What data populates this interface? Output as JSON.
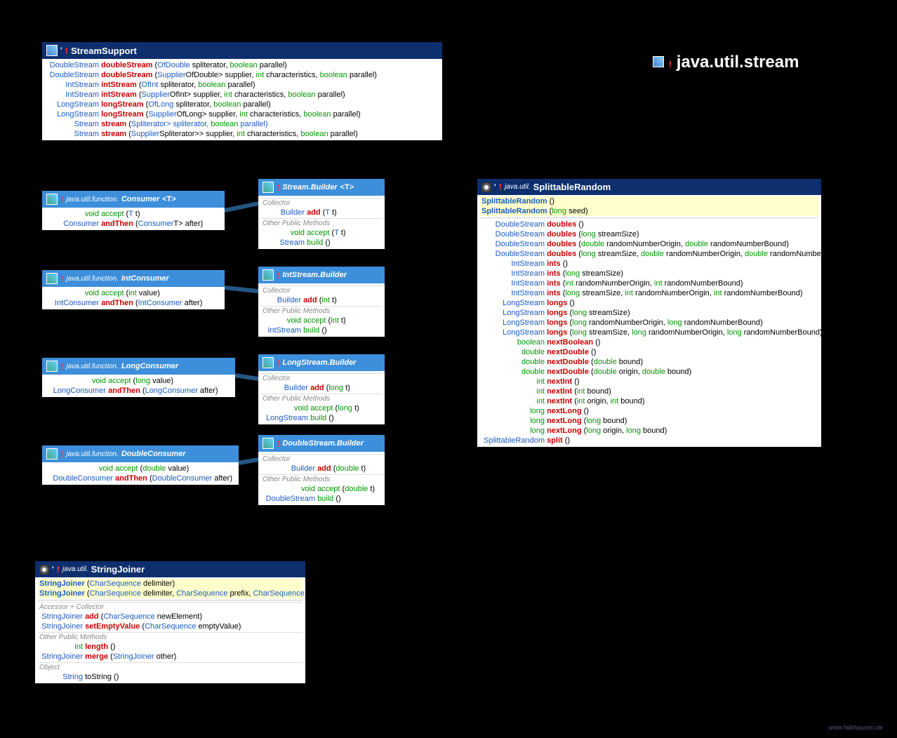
{
  "title": {
    "icon": "class-icon",
    "bang": "!",
    "text": "java.util.stream"
  },
  "footer": "www.falkhausen.de",
  "streamSupport": {
    "header": {
      "bang": "!",
      "name": "StreamSupport"
    },
    "methods": [
      {
        "ret": "DoubleStream",
        "name": "doubleStream",
        "nameClass": "name-r",
        "sig": "(OfDouble spliterator, boolean parallel)",
        "types": [
          [
            "OfDouble",
            "typ"
          ],
          [
            "boolean",
            "kw"
          ]
        ]
      },
      {
        "ret": "DoubleStream",
        "name": "doubleStream",
        "nameClass": "name-r",
        "sig": "(Supplier<? extends OfDouble> supplier, int characteristics, boolean parallel)"
      },
      {
        "ret": "IntStream",
        "name": "intStream",
        "nameClass": "name-r",
        "sig": "(OfInt spliterator, boolean parallel)"
      },
      {
        "ret": "IntStream",
        "name": "intStream",
        "nameClass": "name-r",
        "sig": "(Supplier<? extends OfInt> supplier, int characteristics, boolean parallel)"
      },
      {
        "ret": "LongStream",
        "name": "longStream",
        "nameClass": "name-r",
        "sig": "(OfLong spliterator, boolean parallel)"
      },
      {
        "ret": "LongStream",
        "name": "longStream",
        "nameClass": "name-r",
        "sig": "(Supplier<? extends OfLong> supplier, int characteristics, boolean parallel)"
      },
      {
        "ret": "<T> Stream<T>",
        "name": "stream",
        "nameClass": "name-r",
        "sig": "(Spliterator<T> spliterator, boolean parallel)"
      },
      {
        "ret": "<T> Stream<T>",
        "name": "stream",
        "nameClass": "name-r",
        "sig": "(Supplier<? extends Spliterator<T>> supplier, int characteristics, boolean parallel)"
      }
    ]
  },
  "consumer": {
    "header": {
      "bang": "!",
      "pkg": "java.util.function.",
      "name": "Consumer",
      "tp": "<T>"
    },
    "methods": [
      {
        "ret": "void",
        "name": "accept",
        "nameClass": "name-g",
        "sig": "(T t)"
      },
      {
        "ret": "Consumer<T>",
        "name": "andThen",
        "nameClass": "name-r",
        "sig": "(Consumer<? super T> after)"
      }
    ]
  },
  "intConsumer": {
    "header": {
      "bang": "!",
      "pkg": "java.util.function.",
      "name": "IntConsumer"
    },
    "methods": [
      {
        "ret": "void",
        "name": "accept",
        "nameClass": "name-g",
        "sig": "(int value)"
      },
      {
        "ret": "IntConsumer",
        "name": "andThen",
        "nameClass": "name-r",
        "sig": "(IntConsumer after)"
      }
    ]
  },
  "longConsumer": {
    "header": {
      "bang": "!",
      "pkg": "java.util.function.",
      "name": "LongConsumer"
    },
    "methods": [
      {
        "ret": "void",
        "name": "accept",
        "nameClass": "name-g",
        "sig": "(long value)"
      },
      {
        "ret": "LongConsumer",
        "name": "andThen",
        "nameClass": "name-r",
        "sig": "(LongConsumer after)"
      }
    ]
  },
  "doubleConsumer": {
    "header": {
      "bang": "!",
      "pkg": "java.util.function.",
      "name": "DoubleConsumer"
    },
    "methods": [
      {
        "ret": "void",
        "name": "accept",
        "nameClass": "name-g",
        "sig": "(double value)"
      },
      {
        "ret": "DoubleConsumer",
        "name": "andThen",
        "nameClass": "name-r",
        "sig": "(DoubleConsumer after)"
      }
    ]
  },
  "streamBuilder": {
    "header": {
      "bang": "!",
      "name": "Stream.Builder",
      "tp": "<T>"
    },
    "sections": [
      {
        "label": "Collector",
        "rows": [
          {
            "ret": "Builder<T>",
            "name": "add",
            "nameClass": "name-r",
            "sig": "(T t)"
          }
        ]
      },
      {
        "label": "Other Public Methods",
        "rows": [
          {
            "ret": "void",
            "name": "accept",
            "nameClass": "name-g",
            "sig": "(T t)"
          },
          {
            "ret": "Stream<T>",
            "name": "build",
            "nameClass": "name-g",
            "sig": "()"
          }
        ]
      }
    ]
  },
  "intStreamBuilder": {
    "header": {
      "bang": "!",
      "name": "IntStream.Builder"
    },
    "sections": [
      {
        "label": "Collector",
        "rows": [
          {
            "ret": "Builder",
            "name": "add",
            "nameClass": "name-r",
            "sig": "(int t)"
          }
        ]
      },
      {
        "label": "Other Public Methods",
        "rows": [
          {
            "ret": "void",
            "name": "accept",
            "nameClass": "name-g",
            "sig": "(int t)"
          },
          {
            "ret": "IntStream",
            "name": "build",
            "nameClass": "name-g",
            "sig": "()"
          }
        ]
      }
    ]
  },
  "longStreamBuilder": {
    "header": {
      "bang": "!",
      "name": "LongStream.Builder"
    },
    "sections": [
      {
        "label": "Collector",
        "rows": [
          {
            "ret": "Builder",
            "name": "add",
            "nameClass": "name-r",
            "sig": "(long t)"
          }
        ]
      },
      {
        "label": "Other Public Methods",
        "rows": [
          {
            "ret": "void",
            "name": "accept",
            "nameClass": "name-g",
            "sig": "(long t)"
          },
          {
            "ret": "LongStream",
            "name": "build",
            "nameClass": "name-g",
            "sig": "()"
          }
        ]
      }
    ]
  },
  "doubleStreamBuilder": {
    "header": {
      "bang": "!",
      "name": "DoubleStream.Builder"
    },
    "sections": [
      {
        "label": "Collector",
        "rows": [
          {
            "ret": "Builder",
            "name": "add",
            "nameClass": "name-r",
            "sig": "(double t)"
          }
        ]
      },
      {
        "label": "Other Public Methods",
        "rows": [
          {
            "ret": "void",
            "name": "accept",
            "nameClass": "name-g",
            "sig": "(double t)"
          },
          {
            "ret": "DoubleStream",
            "name": "build",
            "nameClass": "name-g",
            "sig": "()"
          }
        ]
      }
    ]
  },
  "splittableRandom": {
    "header": {
      "bang": "!",
      "pkg": "java.util.",
      "name": "SplittableRandom"
    },
    "ctors": [
      {
        "name": "SplittableRandom",
        "sig": "()"
      },
      {
        "name": "SplittableRandom",
        "sig": "(long seed)"
      }
    ],
    "methods": [
      {
        "ret": "DoubleStream",
        "name": "doubles",
        "nameClass": "name-r",
        "sig": "()"
      },
      {
        "ret": "DoubleStream",
        "name": "doubles",
        "nameClass": "name-r",
        "sig": "(long streamSize)"
      },
      {
        "ret": "DoubleStream",
        "name": "doubles",
        "nameClass": "name-r",
        "sig": "(double randomNumberOrigin, double randomNumberBound)"
      },
      {
        "ret": "DoubleStream",
        "name": "doubles",
        "nameClass": "name-r",
        "sig": "(long streamSize, double randomNumberOrigin, double randomNumberBound)"
      },
      {
        "ret": "IntStream",
        "name": "ints",
        "nameClass": "name-r",
        "sig": "()"
      },
      {
        "ret": "IntStream",
        "name": "ints",
        "nameClass": "name-r",
        "sig": "(long streamSize)"
      },
      {
        "ret": "IntStream",
        "name": "ints",
        "nameClass": "name-r",
        "sig": "(int randomNumberOrigin, int randomNumberBound)"
      },
      {
        "ret": "IntStream",
        "name": "ints",
        "nameClass": "name-r",
        "sig": "(long streamSize, int randomNumberOrigin, int randomNumberBound)"
      },
      {
        "ret": "LongStream",
        "name": "longs",
        "nameClass": "name-r",
        "sig": "()"
      },
      {
        "ret": "LongStream",
        "name": "longs",
        "nameClass": "name-r",
        "sig": "(long streamSize)"
      },
      {
        "ret": "LongStream",
        "name": "longs",
        "nameClass": "name-r",
        "sig": "(long randomNumberOrigin, long randomNumberBound)"
      },
      {
        "ret": "LongStream",
        "name": "longs",
        "nameClass": "name-r",
        "sig": "(long streamSize, long randomNumberOrigin, long randomNumberBound)"
      },
      {
        "ret": "boolean",
        "name": "nextBoolean",
        "nameClass": "name-r",
        "sig": "()",
        "retClass": "kw"
      },
      {
        "ret": "double",
        "name": "nextDouble",
        "nameClass": "name-r",
        "sig": "()",
        "retClass": "kw"
      },
      {
        "ret": "double",
        "name": "nextDouble",
        "nameClass": "name-r",
        "sig": "(double bound)",
        "retClass": "kw"
      },
      {
        "ret": "double",
        "name": "nextDouble",
        "nameClass": "name-r",
        "sig": "(double origin, double bound)",
        "retClass": "kw"
      },
      {
        "ret": "int",
        "name": "nextInt",
        "nameClass": "name-r",
        "sig": "()",
        "retClass": "kw"
      },
      {
        "ret": "int",
        "name": "nextInt",
        "nameClass": "name-r",
        "sig": "(int bound)",
        "retClass": "kw"
      },
      {
        "ret": "int",
        "name": "nextInt",
        "nameClass": "name-r",
        "sig": "(int origin, int bound)",
        "retClass": "kw"
      },
      {
        "ret": "long",
        "name": "nextLong",
        "nameClass": "name-r",
        "sig": "()",
        "retClass": "kw"
      },
      {
        "ret": "long",
        "name": "nextLong",
        "nameClass": "name-r",
        "sig": "(long bound)",
        "retClass": "kw"
      },
      {
        "ret": "long",
        "name": "nextLong",
        "nameClass": "name-r",
        "sig": "(long origin, long bound)",
        "retClass": "kw"
      },
      {
        "ret": "SplittableRandom",
        "name": "split",
        "nameClass": "name-r",
        "sig": "()"
      }
    ]
  },
  "stringJoiner": {
    "header": {
      "bang": "!",
      "pkg": "java.util.",
      "name": "StringJoiner"
    },
    "ctors": [
      {
        "name": "StringJoiner",
        "sig": "(CharSequence delimiter)"
      },
      {
        "name": "StringJoiner",
        "sig": "(CharSequence delimiter, CharSequence prefix, CharSequence suffix)"
      }
    ],
    "sections": [
      {
        "label": "Accessor + Collector",
        "rows": [
          {
            "ret": "StringJoiner",
            "name": "add",
            "nameClass": "name-r",
            "sig": "(CharSequence newElement)"
          },
          {
            "ret": "StringJoiner",
            "name": "setEmptyValue",
            "nameClass": "name-r",
            "sig": "(CharSequence emptyValue)"
          }
        ]
      },
      {
        "label": "Other Public Methods",
        "rows": [
          {
            "ret": "int",
            "name": "length",
            "nameClass": "name-r",
            "sig": "()",
            "retClass": "kw"
          },
          {
            "ret": "StringJoiner",
            "name": "merge",
            "nameClass": "name-r",
            "sig": "(StringJoiner other)"
          }
        ]
      },
      {
        "label": "Object",
        "rows": [
          {
            "ret": "String",
            "name": "toString",
            "nameClass": "name-n",
            "sig": "()"
          }
        ]
      }
    ]
  }
}
